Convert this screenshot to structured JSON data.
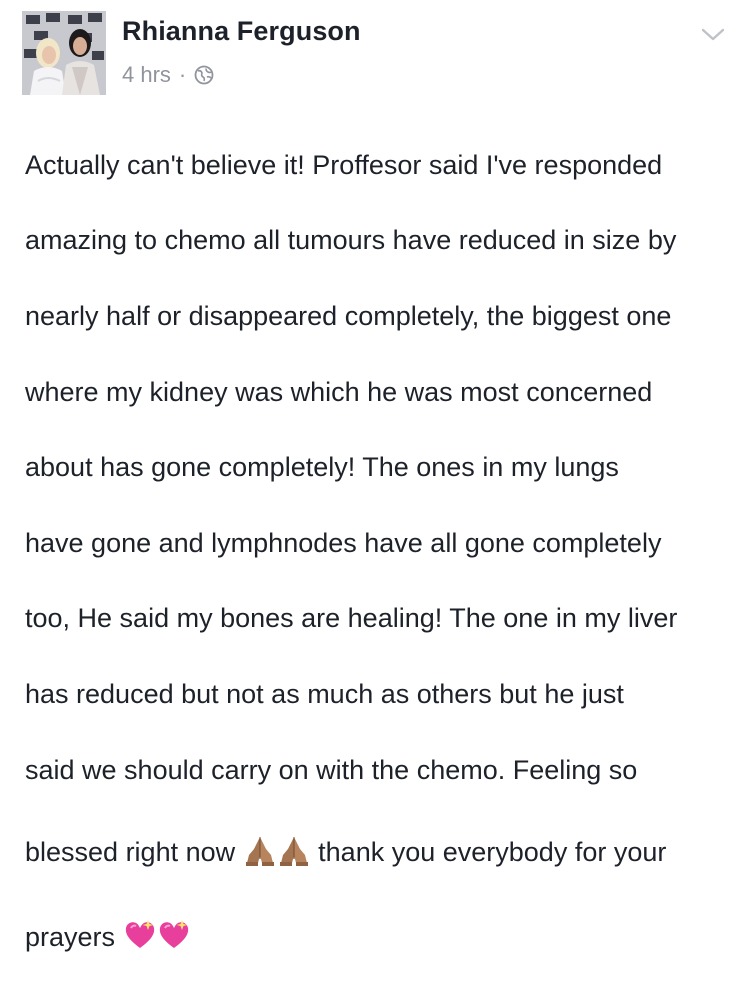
{
  "post": {
    "author_name": "Rhianna Ferguson",
    "timestamp": "4 hrs",
    "separator": "·",
    "privacy_icon": "globe-icon",
    "menu_icon": "chevron-down-icon",
    "lines": [
      "Actually can't believe it! Proffesor said I've responded",
      "amazing to chemo all tumours have reduced in size by",
      "nearly half or disappeared completely, the biggest one",
      "where my kidney was which he was most concerned",
      "about has gone completely! The ones in my lungs",
      "have gone and lymphnodes have all gone completely",
      "too, He said my bones are healing! The one in my liver",
      "has reduced but not as much as others but he just",
      "said we should carry on with the chemo. Feeling so"
    ],
    "line_10_start": "blessed right now",
    "line_10_end": "thank you everybody for your",
    "line_11": "prayers",
    "emojis": {
      "praying": "folded-hands-emoji",
      "heart": "sparkling-heart-emoji"
    }
  },
  "colors": {
    "text": "#1d2129",
    "meta": "#90949c",
    "background": "#ffffff"
  }
}
